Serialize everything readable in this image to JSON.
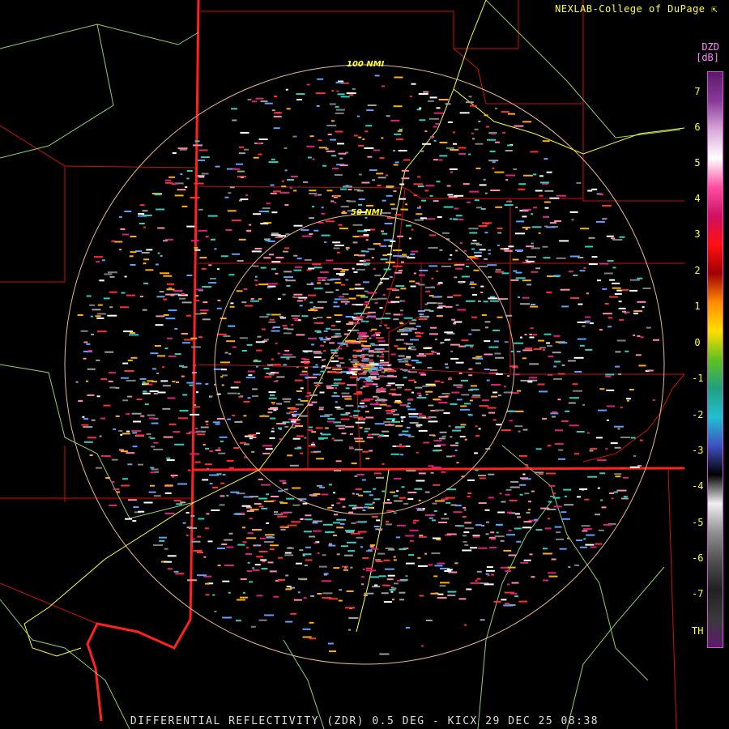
{
  "credit": "NEXLAB-College of DuPage",
  "product_code": "DZD",
  "units": "[dB]",
  "colorbar": {
    "ticks": [
      "7",
      "6",
      "5",
      "4",
      "3",
      "2",
      "1",
      "0",
      "-1",
      "-2",
      "-3",
      "-4",
      "-5",
      "-6",
      "-7",
      "TH"
    ],
    "stops": [
      "#5a1a6a",
      "#8a3a9a",
      "#d8a8d8",
      "#ffffff",
      "#ff4fa0",
      "#d01060",
      "#ff1010",
      "#a00000",
      "#ff8a00",
      "#ffe000",
      "#60c020",
      "#20a080",
      "#20c0d0",
      "#4050c0",
      "#000000",
      "#f0f0f0",
      "#909090",
      "#505050",
      "#202020",
      "#3a3a3a",
      "#5c1a6c"
    ]
  },
  "range_rings": [
    "50 NMI",
    "100 NMI"
  ],
  "footer": "DIFFERENTIAL REFLECTIVITY (ZDR) 0.5 DEG - KICX 29 DEC 25 08:38",
  "colors": {
    "state_border": "#ff2020",
    "county_border": "#cc1010",
    "highway": "#ffff33",
    "terrain_line": "#8fcf6a",
    "range_ring": "#e8b890"
  }
}
